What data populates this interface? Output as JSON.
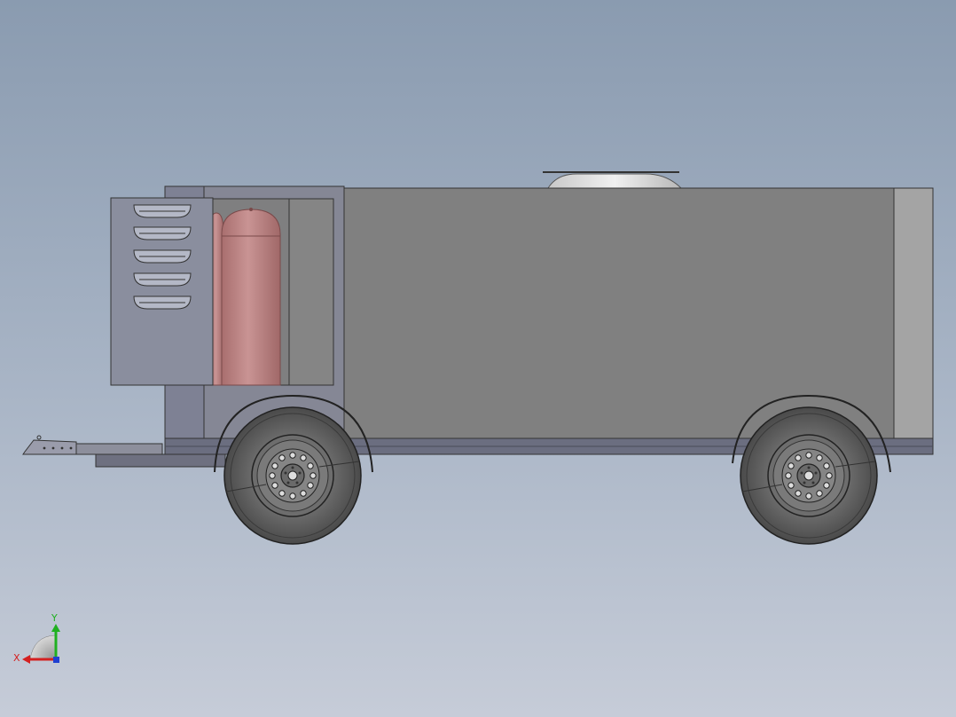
{
  "viewport": {
    "background_top": "#8a9bb0",
    "background_bottom": "#c6ccd8"
  },
  "triad": {
    "x_label": "X",
    "y_label": "Y",
    "x_color": "#d42020",
    "y_color": "#20b020",
    "z_color": "#2040d0"
  },
  "model": {
    "body_color": "#808080",
    "panel_color": "#8a8e9e",
    "tank_color": "#b88080",
    "tire_color": "#555555"
  }
}
